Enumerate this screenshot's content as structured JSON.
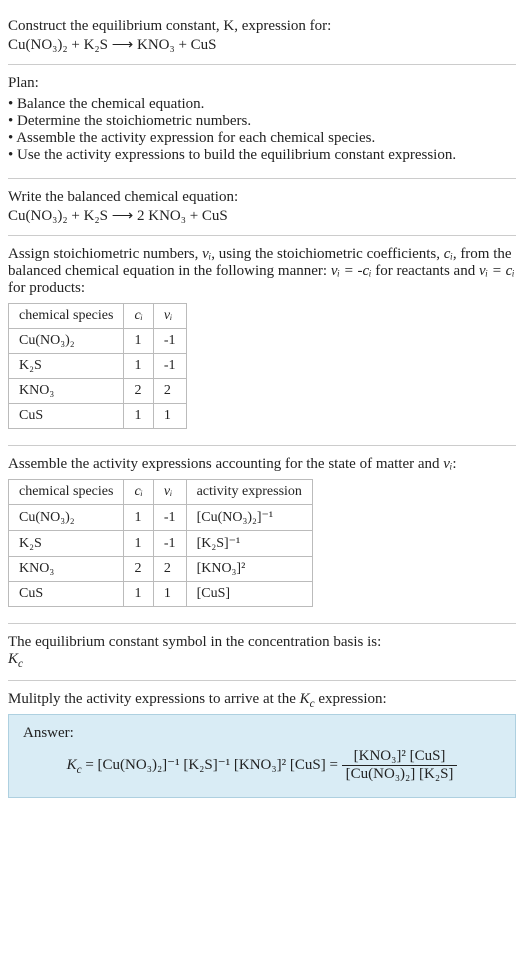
{
  "intro": {
    "line1": "Construct the equilibrium constant, K, expression for:",
    "equation": "Cu(NO₃)₂ + K₂S ⟶ KNO₃ + CuS"
  },
  "plan": {
    "header": "Plan:",
    "items": [
      "Balance the chemical equation.",
      "Determine the stoichiometric numbers.",
      "Assemble the activity expression for each chemical species.",
      "Use the activity expressions to build the equilibrium constant expression."
    ]
  },
  "balanced": {
    "header": "Write the balanced chemical equation:",
    "equation": "Cu(NO₃)₂ + K₂S ⟶ 2 KNO₃ + CuS"
  },
  "stoich": {
    "intro_a": "Assign stoichiometric numbers, ",
    "intro_b": ", using the stoichiometric coefficients, ",
    "intro_c": ", from the balanced chemical equation in the following manner: ",
    "intro_d": " for reactants and ",
    "intro_e": " for products:",
    "nu": "νᵢ",
    "ci": "cᵢ",
    "eq_react": "νᵢ = -cᵢ",
    "eq_prod": "νᵢ = cᵢ",
    "table": {
      "h1": "chemical species",
      "h2": "cᵢ",
      "h3": "νᵢ",
      "rows": [
        {
          "sp": "Cu(NO₃)₂",
          "c": "1",
          "v": "-1"
        },
        {
          "sp": "K₂S",
          "c": "1",
          "v": "-1"
        },
        {
          "sp": "KNO₃",
          "c": "2",
          "v": "2"
        },
        {
          "sp": "CuS",
          "c": "1",
          "v": "1"
        }
      ]
    }
  },
  "activity": {
    "intro_a": "Assemble the activity expressions accounting for the state of matter and ",
    "intro_b": ":",
    "nu": "νᵢ",
    "table": {
      "h1": "chemical species",
      "h2": "cᵢ",
      "h3": "νᵢ",
      "h4": "activity expression",
      "rows": [
        {
          "sp": "Cu(NO₃)₂",
          "c": "1",
          "v": "-1",
          "expr": "[Cu(NO₃)₂]⁻¹"
        },
        {
          "sp": "K₂S",
          "c": "1",
          "v": "-1",
          "expr": "[K₂S]⁻¹"
        },
        {
          "sp": "KNO₃",
          "c": "2",
          "v": "2",
          "expr": "[KNO₃]²"
        },
        {
          "sp": "CuS",
          "c": "1",
          "v": "1",
          "expr": "[CuS]"
        }
      ]
    }
  },
  "kc_symbol": {
    "line": "The equilibrium constant symbol in the concentration basis is:",
    "sym": "K_c"
  },
  "multiply": {
    "line_a": "Mulitply the activity expressions to arrive at the ",
    "kc": "K_c",
    "line_b": " expression:"
  },
  "answer": {
    "label": "Answer:",
    "lhs": "K_c = [Cu(NO₃)₂]⁻¹ [K₂S]⁻¹ [KNO₃]² [CuS] = ",
    "num": "[KNO₃]² [CuS]",
    "den": "[Cu(NO₃)₂] [K₂S]"
  }
}
